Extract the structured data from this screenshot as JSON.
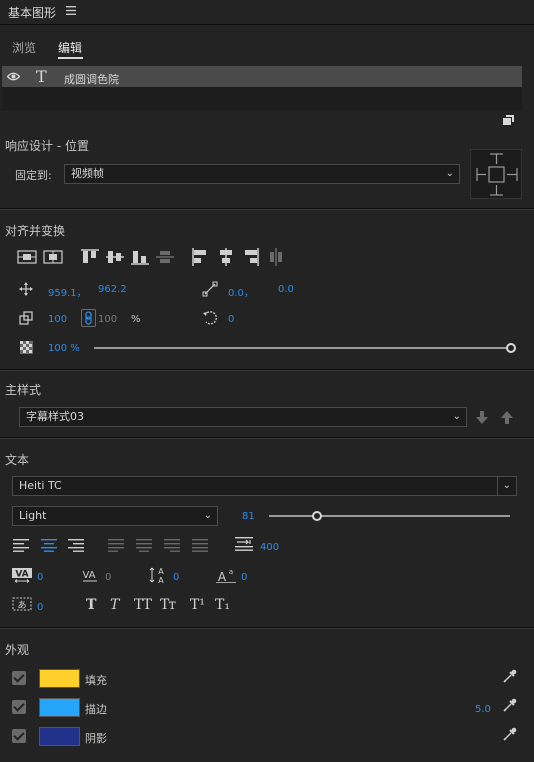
{
  "panel": {
    "title": "基本图形",
    "menu_icon": "hamburger-icon"
  },
  "tabs": [
    {
      "label": "浏览"
    },
    {
      "label": "编辑",
      "active": true
    }
  ],
  "layers": [
    {
      "label": "成圆调色院",
      "type_icon": "text-icon",
      "visible": true
    }
  ],
  "responsive": {
    "section_title": "响应设计 - 位置",
    "pin_label": "固定到:",
    "pin_value": "视频帧"
  },
  "align": {
    "section_title": "对齐并变换",
    "position_x": "959.1，",
    "position_y": "962.2",
    "anchor_x": "0.0，",
    "anchor_y": "0.0",
    "scale_w": "100",
    "scale_h": "100",
    "scale_unit": "%",
    "rotation": "0",
    "opacity": "100 %",
    "opacity_value": 1.0
  },
  "master_style": {
    "section_title": "主样式",
    "value": "字幕样式03"
  },
  "text": {
    "section_title": "文本",
    "font_family": "Heiti TC",
    "font_style": "Light",
    "font_size": "81",
    "tab_width": "400",
    "kerning": "0",
    "tracking": "0",
    "leading": "0",
    "baseline": "0",
    "tsume": "0",
    "style_buttons": [
      "T",
      "T",
      "TT",
      "Tт",
      "T¹",
      "T₁"
    ]
  },
  "appearance": {
    "section_title": "外观",
    "fill": {
      "label": "填充",
      "color": "#ffd02c",
      "checked": true
    },
    "stroke": {
      "label": "描边",
      "color": "#25a6fb",
      "width": "5.0",
      "checked": true
    },
    "shadow": {
      "label": "阴影",
      "color": "#22318a",
      "checked": true
    }
  }
}
